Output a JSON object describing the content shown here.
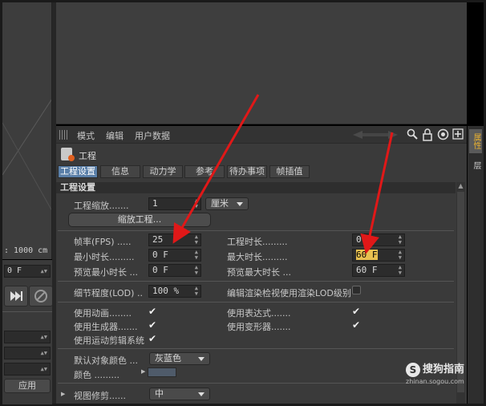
{
  "left_panel": {
    "scale_readout": ": 1000 cm",
    "field1": "0 F",
    "apply_label": "应用"
  },
  "toolbar": {
    "menu": [
      "模式",
      "编辑",
      "用户数据"
    ],
    "icons": [
      "search-icon",
      "lock-icon",
      "target-icon",
      "add-icon"
    ]
  },
  "object": {
    "title": "工程"
  },
  "tabs": [
    {
      "label": "工程设置",
      "active": true
    },
    {
      "label": "信息",
      "active": false
    },
    {
      "label": "动力学",
      "active": false
    },
    {
      "label": "参考",
      "active": false
    },
    {
      "label": "待办事项",
      "active": false
    },
    {
      "label": "帧插值",
      "active": false
    }
  ],
  "section": {
    "title": "工程设置"
  },
  "project_scale": {
    "label": "工程缩放.......",
    "value": "1",
    "unit": "厘米",
    "scale_button": "缩放工程..."
  },
  "fps": {
    "label": "帧率(FPS) .....",
    "value": "25"
  },
  "project_duration": {
    "label": "工程时长.........",
    "value": "0 F"
  },
  "min_duration": {
    "label": "最小时长.........",
    "value": "0 F"
  },
  "max_duration": {
    "label": "最大时长.........",
    "value": "60 F"
  },
  "preview_min": {
    "label": "预览最小时长 ...",
    "value": "0 F"
  },
  "preview_max": {
    "label": "预览最大时长 ...",
    "value": "60 F"
  },
  "lod": {
    "label": "细节程度(LOD) ..",
    "value": "100 %"
  },
  "editor_lod": {
    "label": "编辑渲染检视使用渲染LOD级别",
    "checked": false
  },
  "animation": {
    "label": "使用动画........",
    "checked": true
  },
  "expressions": {
    "label": "使用表达式.......",
    "checked": true
  },
  "generators": {
    "label": "使用生成器.......",
    "checked": true
  },
  "deformers": {
    "label": "使用变形器.......",
    "checked": true
  },
  "motion_system": {
    "label": "使用运动剪辑系统",
    "checked": true
  },
  "default_color": {
    "label": "默认对象颜色 ...",
    "value": "灰蓝色"
  },
  "color": {
    "label": "颜色 .........",
    "swatch": "#4f5b6a"
  },
  "view_clipping": {
    "label": "视图修剪......",
    "value": "中"
  },
  "side_tabs": [
    "属性",
    "层"
  ],
  "watermark": {
    "name": "搜狗指南",
    "url": "zhinan.sogou.com"
  },
  "colors": {
    "accent": "#5a7fa8",
    "arrow": "#e01818",
    "highlight": "#e8c050"
  }
}
